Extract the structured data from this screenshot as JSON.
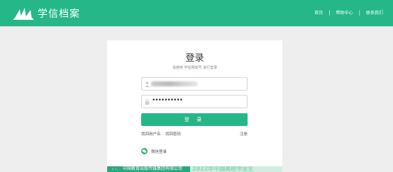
{
  "header": {
    "brand": "学信档案",
    "nav": [
      "首页",
      "帮助中心",
      "联系我们"
    ]
  },
  "login": {
    "title": "登录",
    "subtitle": "请使用 学信网账号 进行登录",
    "password_mask": "••••••••••",
    "button": "登 录",
    "forgot_username": "找回用户名",
    "forgot_password": "找回密码",
    "register": "注册",
    "wechat_login": "微信登录"
  },
  "banner": {
    "text": "中国教育出版传媒集团有限公司",
    "faded_text": "2022年中国高校毕业生"
  },
  "colors": {
    "brand_green": "#25b787",
    "background": "#eeeeee"
  },
  "icons": [
    "logo-mark",
    "user-icon",
    "lock-icon",
    "wechat-icon"
  ]
}
